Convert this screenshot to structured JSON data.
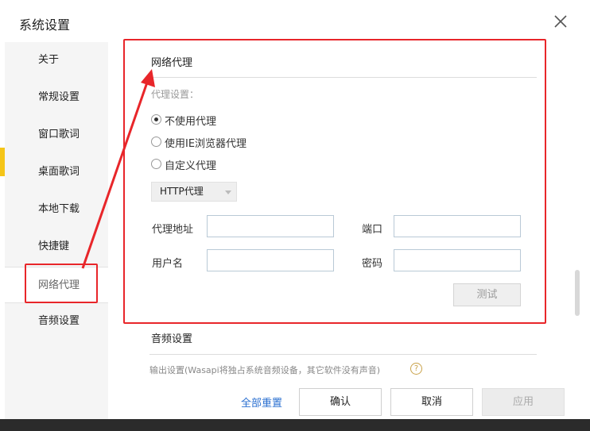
{
  "dialog": {
    "title": "系统设置"
  },
  "sidebar": {
    "items": [
      {
        "label": "关于"
      },
      {
        "label": "常规设置"
      },
      {
        "label": "窗口歌词"
      },
      {
        "label": "桌面歌词"
      },
      {
        "label": "本地下载"
      },
      {
        "label": "快捷键"
      },
      {
        "label": "网络代理",
        "active": true
      },
      {
        "label": "音频设置"
      }
    ]
  },
  "proxy": {
    "section_title": "网络代理",
    "settings_label": "代理设置：",
    "options": [
      {
        "label": "不使用代理",
        "checked": true
      },
      {
        "label": "使用IE浏览器代理",
        "checked": false
      },
      {
        "label": "自定义代理",
        "checked": false
      }
    ],
    "type_select": "HTTP代理",
    "address_label": "代理地址",
    "address_value": "",
    "port_label": "端口",
    "port_value": "",
    "username_label": "用户名",
    "username_value": "",
    "password_label": "密码",
    "password_value": "",
    "test_button": "测试"
  },
  "audio": {
    "section_title": "音频设置",
    "output_desc": "输出设置(Wasapi将独占系统音频设备，其它软件没有声音)"
  },
  "footer": {
    "reset_label": "全部重置",
    "ok_label": "确认",
    "cancel_label": "取消",
    "apply_label": "应用"
  },
  "colors": {
    "highlight": "#e8262a",
    "link": "#2a6fd0"
  }
}
